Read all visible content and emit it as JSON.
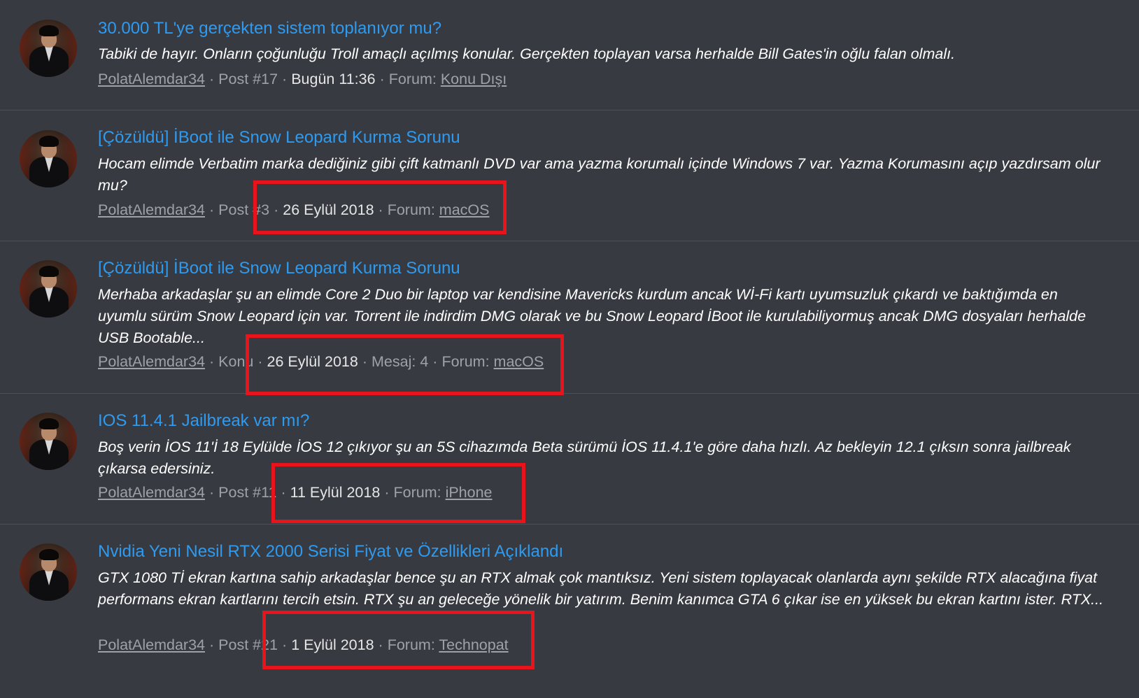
{
  "results": [
    {
      "title": "30.000 TL'ye gerçekten sistem toplanıyor mu?",
      "snippet": "Tabiki de hayır. Onların çoğunluğu Troll amaçlı açılmış konular. Gerçekten toplayan varsa herhalde Bill Gates'in oğlu falan olmalı.",
      "author": "PolatAlemdar34",
      "type": "Post #17",
      "date": "Bugün 11:36",
      "extra": "",
      "forum_label": "Forum:",
      "forum": "Konu Dışı"
    },
    {
      "title": "[Çözüldü] İBoot ile Snow Leopard Kurma Sorunu",
      "snippet": "Hocam elimde Verbatim marka dediğiniz gibi çift katmanlı DVD var ama yazma korumalı içinde Windows 7 var. Yazma Korumasını açıp yazdırsam olur mu?",
      "author": "PolatAlemdar34",
      "type": "Post #3",
      "date": "26 Eylül 2018",
      "extra": "",
      "forum_label": "Forum:",
      "forum": "macOS"
    },
    {
      "title": "[Çözüldü] İBoot ile Snow Leopard Kurma Sorunu",
      "snippet": "Merhaba arkadaşlar şu an elimde Core 2 Duo bir laptop var kendisine Mavericks kurdum ancak Wİ-Fi kartı uyumsuzluk çıkardı ve baktığımda en uyumlu sürüm Snow Leopard için var. Torrent ile indirdim DMG olarak ve bu Snow Leopard İBoot ile kurulabiliyormuş ancak DMG dosyaları herhalde USB Bootable...",
      "author": "PolatAlemdar34",
      "type": "Konu",
      "date": "26 Eylül 2018",
      "extra": "Mesaj: 4",
      "forum_label": "Forum:",
      "forum": "macOS"
    },
    {
      "title": "IOS 11.4.1 Jailbreak var mı?",
      "snippet": "Boş verin İOS 11'İ 18 Eylülde İOS 12 çıkıyor şu an 5S cihazımda Beta sürümü İOS 11.4.1'e göre daha hızlı. Az bekleyin 12.1 çıksın sonra jailbreak çıkarsa edersiniz.",
      "author": "PolatAlemdar34",
      "type": "Post #11",
      "date": "11 Eylül 2018",
      "extra": "",
      "forum_label": "Forum:",
      "forum": "iPhone"
    },
    {
      "title": "Nvidia Yeni Nesil RTX 2000 Serisi Fiyat ve Özellikleri Açıklandı",
      "snippet": "GTX 1080 Tİ ekran kartına sahip arkadaşlar bence şu an RTX almak çok mantıksız. Yeni sistem toplayacak olanlarda aynı şekilde RTX alacağına fiyat performans ekran kartlarını tercih etsin. RTX şu an geleceğe yönelik bir yatırım. Benim kanımca GTA 6 çıkar ise en yüksek bu ekran kartını ister. RTX...",
      "author": "PolatAlemdar34",
      "type": "Post #21",
      "date": "1 Eylül 2018",
      "extra": "",
      "forum_label": "Forum:",
      "forum": "Technopat"
    }
  ],
  "colors": {
    "background": "#373a41",
    "link": "#2e9bf0",
    "highlight": "#e8141b"
  }
}
